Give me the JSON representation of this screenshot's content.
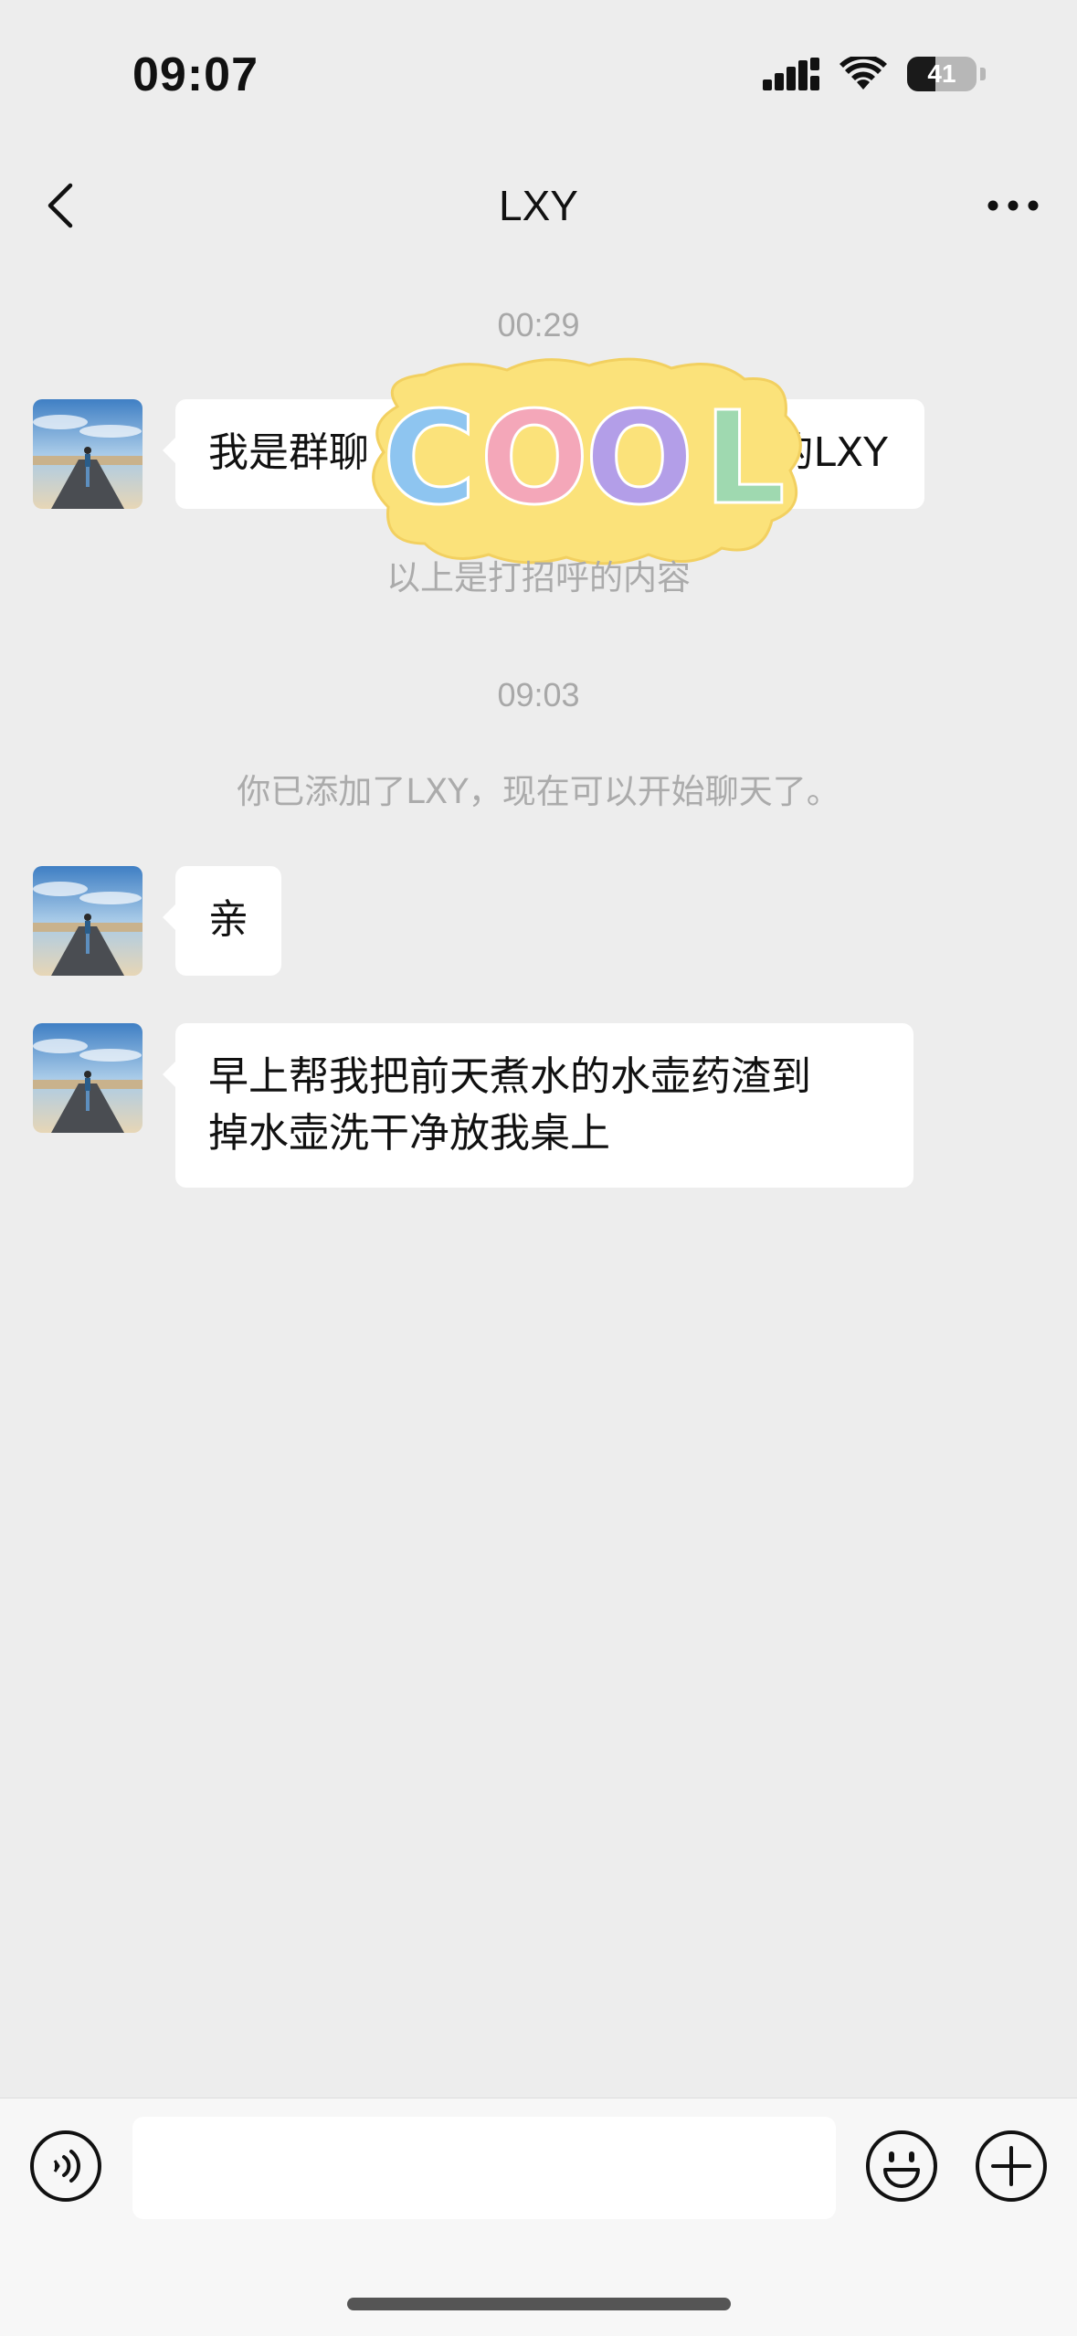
{
  "status_bar": {
    "time": "09:07",
    "battery_level": "41",
    "battery_fraction": 0.41
  },
  "nav": {
    "title": "LXY",
    "back_icon": "chevron-left-icon",
    "more_icon": "more-dots-icon"
  },
  "messages": {
    "ts1": "00:29",
    "greeting": "我是群聊“”的LXY",
    "greeting_visible_left": "我是群聊",
    "greeting_visible_right": "的LXY",
    "greeting_footer": "以上是打招呼的内容",
    "ts2": "09:03",
    "added_notice": "你已添加了LXY，现在可以开始聊天了。",
    "msg1": "亲",
    "msg2_line1": "早上帮我把前天煮水的水壶药渣到",
    "msg2_line2": "掉水壶洗干净放我桌上"
  },
  "sticker": {
    "text": "COOL",
    "letters": [
      "C",
      "O",
      "O",
      "L"
    ],
    "colors": [
      "#8ec5f0",
      "#f4a7b9",
      "#b39ee8",
      "#9fd9b0"
    ],
    "blob_color": "#fbe27a"
  },
  "input_bar": {
    "value": "",
    "voice_icon": "voice-icon",
    "emoji_icon": "emoji-icon",
    "plus_icon": "plus-icon"
  }
}
